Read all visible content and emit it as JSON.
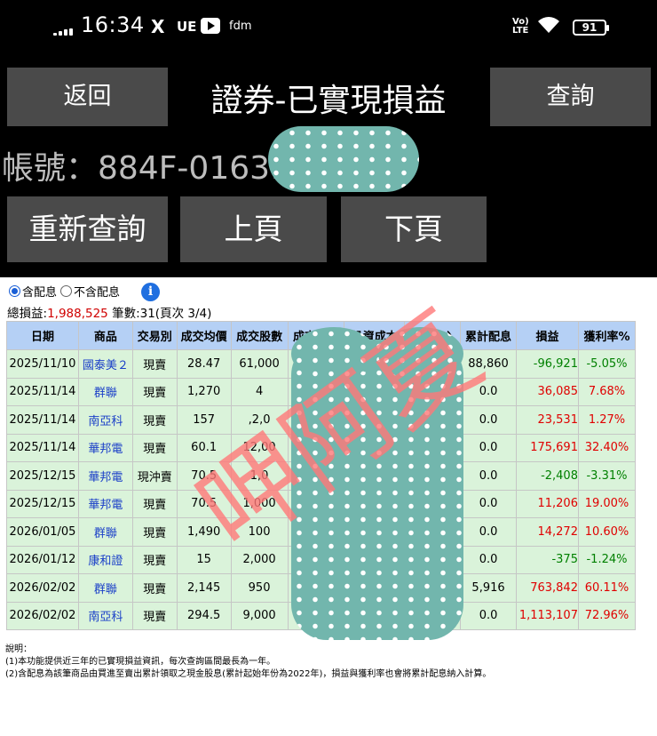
{
  "status_bar": {
    "time": "16:34",
    "icons": [
      "X",
      "UE",
      "fdm"
    ],
    "network": "Vo) LTE",
    "battery": "91"
  },
  "header": {
    "back_label": "返回",
    "title": "證券-已實現損益",
    "query_label": "查詢"
  },
  "account": {
    "label": "帳號：884F-01631"
  },
  "nav": {
    "requery_label": "重新查詢",
    "prev_label": "上頁",
    "next_label": "下頁"
  },
  "filter": {
    "options": [
      {
        "label": "含配息",
        "selected": true
      },
      {
        "label": "不含配息",
        "selected": false
      }
    ],
    "info_icon": "i"
  },
  "summary": {
    "total_label": "總損益:",
    "total_value": "1,988,525",
    "count_text": "筆數:31(頁次 3/4)"
  },
  "table": {
    "headers": [
      "日期",
      "商品",
      "交易別",
      "成交均價",
      "成交股數",
      "成交價金",
      "投資成本",
      "帳面收入",
      "累計配息",
      "損益",
      "獲利率%"
    ],
    "rows": [
      {
        "date": "2025/11/10",
        "product": "國泰美２",
        "type": "現賣",
        "avg_price": "28.47",
        "shares": "61,000",
        "amount": "1",
        "cost": "",
        "income": "27",
        "dividend": "88,860",
        "pnl": "-96,921",
        "rate": "-5.05%",
        "sign": "neg"
      },
      {
        "date": "2025/11/14",
        "product": "群聯",
        "type": "現賣",
        "avg_price": "1,270",
        "shares": "4",
        "amount": "",
        "cost": "",
        "income": "",
        "dividend": "0.0",
        "pnl": "36,085",
        "rate": "7.68%",
        "sign": "pos"
      },
      {
        "date": "2025/11/14",
        "product": "南亞科",
        "type": "現賣",
        "avg_price": "157",
        "shares": ",2,0",
        "amount": "",
        "cost": "",
        "income": "",
        "dividend": "0.0",
        "pnl": "23,531",
        "rate": "1.27%",
        "sign": "pos"
      },
      {
        "date": "2025/11/14",
        "product": "華邦電",
        "type": "現賣",
        "avg_price": "60.1",
        "shares": "12,00",
        "amount": "",
        "cost": "",
        "income": "",
        "dividend": "0.0",
        "pnl": "175,691",
        "rate": "32.40%",
        "sign": "pos"
      },
      {
        "date": "2025/12/15",
        "product": "華邦電",
        "type": "現沖賣",
        "avg_price": "70.5",
        "shares": "1,0",
        "amount": "",
        "cost": "",
        "income": "",
        "dividend": "0.0",
        "pnl": "-2,408",
        "rate": "-3.31%",
        "sign": "neg"
      },
      {
        "date": "2025/12/15",
        "product": "華邦電",
        "type": "現賣",
        "avg_price": "70.5",
        "shares": "1,000",
        "amount": "",
        "cost": "",
        "income": "",
        "dividend": "0.0",
        "pnl": "11,206",
        "rate": "19.00%",
        "sign": "pos"
      },
      {
        "date": "2026/01/05",
        "product": "群聯",
        "type": "現賣",
        "avg_price": "1,490",
        "shares": "100",
        "amount": "",
        "cost": "",
        "income": "622",
        "dividend": "0.0",
        "pnl": "14,272",
        "rate": "10.60%",
        "sign": "pos"
      },
      {
        "date": "2026/01/12",
        "product": "康和證",
        "type": "現賣",
        "avg_price": "15",
        "shares": "2,000",
        "amount": "",
        "cost": "",
        "income": "",
        "dividend": "0.0",
        "pnl": "-375",
        "rate": "-1.24%",
        "sign": "neg"
      },
      {
        "date": "2026/02/02",
        "product": "群聯",
        "type": "現賣",
        "avg_price": "2,145",
        "shares": "950",
        "amount": "2",
        "cost": "",
        "income": "",
        "dividend": "5,916",
        "pnl": "763,842",
        "rate": "60.11%",
        "sign": "pos"
      },
      {
        "date": "2026/02/02",
        "product": "南亞科",
        "type": "現賣",
        "avg_price": "294.5",
        "shares": "9,000",
        "amount": "2,",
        "cost": "",
        "income": "",
        "dividend": "0.0",
        "pnl": "1,113,107",
        "rate": "72.96%",
        "sign": "pos"
      }
    ]
  },
  "notes": {
    "title": "說明：",
    "line1": "(1)本功能提供近三年的已實現損益資訊，每次查詢區間最長為一年。",
    "line2": "(2)含配息為該筆商品由買進至賣出累計領取之現金股息(累計起始年份為2022年)，損益與獲利率也會將累計配息納入計算。"
  },
  "overlay": {
    "text": "呷阿夏"
  },
  "colors": {
    "header_bg": "#000000",
    "button_bg": "#4a4a4a",
    "table_header_bg": "#b5d0f5",
    "table_row_bg": "#daf3da",
    "positive": "#e00000",
    "negative": "#008000",
    "product_link": "#1a3fc8",
    "mask": "#72b6ad"
  }
}
